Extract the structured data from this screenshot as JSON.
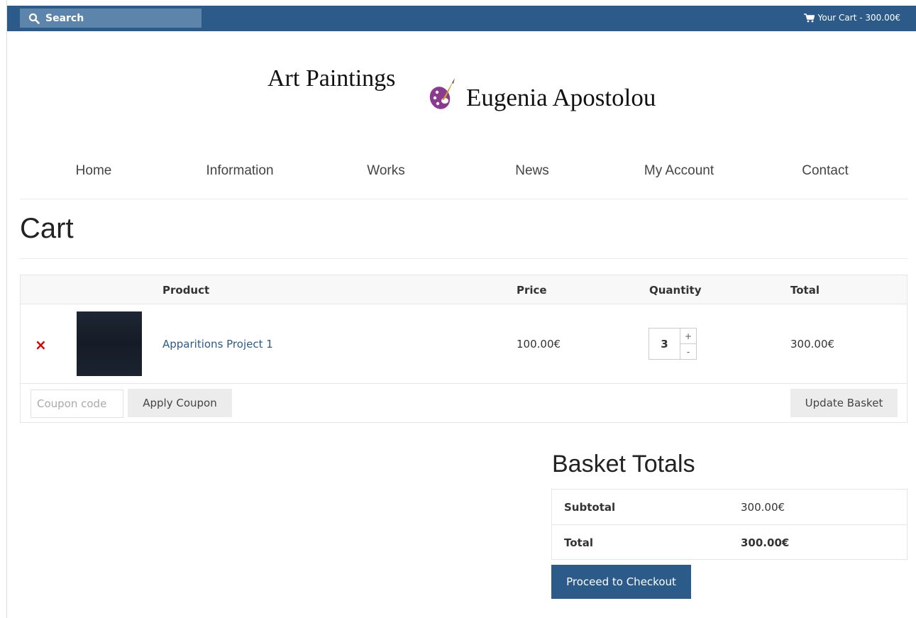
{
  "topbar": {
    "search_label": "Search",
    "cart_label": "Your Cart - 300.00€"
  },
  "header": {
    "logo_left": "Art Paintings",
    "logo_right": "Eugenia Apostolou"
  },
  "nav": {
    "items": [
      {
        "label": "Home"
      },
      {
        "label": "Information"
      },
      {
        "label": "Works"
      },
      {
        "label": "News"
      },
      {
        "label": "My Account"
      },
      {
        "label": "Contact"
      }
    ]
  },
  "page": {
    "title": "Cart"
  },
  "cart": {
    "columns": {
      "product": "Product",
      "price": "Price",
      "quantity": "Quantity",
      "total": "Total"
    },
    "items": [
      {
        "remove_symbol": "×",
        "name": "Apparitions Project 1",
        "price": "100.00€",
        "quantity": "3",
        "total": "300.00€"
      }
    ],
    "qty_plus": "+",
    "qty_minus": "-",
    "coupon_placeholder": "Coupon code",
    "apply_coupon": "Apply Coupon",
    "update_basket": "Update Basket"
  },
  "totals": {
    "title": "Basket Totals",
    "subtotal_label": "Subtotal",
    "subtotal_value": "300.00€",
    "total_label": "Total",
    "total_value": "300.00€",
    "checkout": "Proceed to Checkout"
  },
  "colors": {
    "brand": "#2c5b89",
    "search_bg": "#5d84aa",
    "remove": "#dd0000",
    "palette_icon": "#8b3a8f"
  },
  "icons": [
    "search-icon",
    "cart-icon",
    "palette-icon",
    "remove-icon"
  ]
}
